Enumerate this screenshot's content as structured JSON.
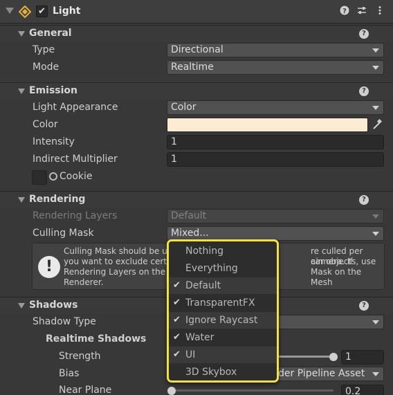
{
  "header": {
    "title": "Light",
    "enabled": true,
    "icons": [
      "light-icon",
      "help-icon",
      "preset-icon",
      "menu-icon"
    ]
  },
  "general": {
    "title": "General",
    "type_label": "Type",
    "type_value": "Directional",
    "mode_label": "Mode",
    "mode_value": "Realtime"
  },
  "emission": {
    "title": "Emission",
    "light_appearance_label": "Light Appearance",
    "light_appearance_value": "Color",
    "color_label": "Color",
    "color_hex": "#fdecd2",
    "intensity_label": "Intensity",
    "intensity_value": "1",
    "indirect_label": "Indirect Multiplier",
    "indirect_value": "1",
    "cookie_label": "Cookie"
  },
  "rendering": {
    "title": "Rendering",
    "rendering_layers_label": "Rendering Layers",
    "rendering_layers_value": "Default",
    "culling_mask_label": "Culling Mask",
    "culling_mask_value": "Mixed...",
    "help_line1": "Culling Mask should be u",
    "help_line1b": "re culled per camera. If",
    "help_line2": "you want to exclude cert",
    "help_line2b": "ain objects, use",
    "help_line3": "Rendering Layers on the",
    "help_line3b": "Mask on the Mesh",
    "help_line4": "Renderer."
  },
  "shadows": {
    "title": "Shadows",
    "shadow_type_label": "Shadow Type",
    "realtime_label": "Realtime Shadows",
    "strength_label": "Strength",
    "strength_value": "1",
    "strength_level": 1.0,
    "bias_label": "Bias",
    "bias_value": "der Pipeline Asset",
    "near_plane_label": "Near Plane",
    "near_plane_value": "0.2",
    "near_plane_level": 0.0
  },
  "culling_popup": {
    "items": [
      {
        "label": "Nothing",
        "checked": false
      },
      {
        "label": "Everything",
        "checked": false
      },
      {
        "label": "Default",
        "checked": true
      },
      {
        "label": "TransparentFX",
        "checked": true
      },
      {
        "label": "Ignore Raycast",
        "checked": true
      },
      {
        "label": "Water",
        "checked": true
      },
      {
        "label": "UI",
        "checked": true
      },
      {
        "label": "3D Skybox",
        "checked": false
      }
    ],
    "highlight_color": "#f4e23a"
  }
}
